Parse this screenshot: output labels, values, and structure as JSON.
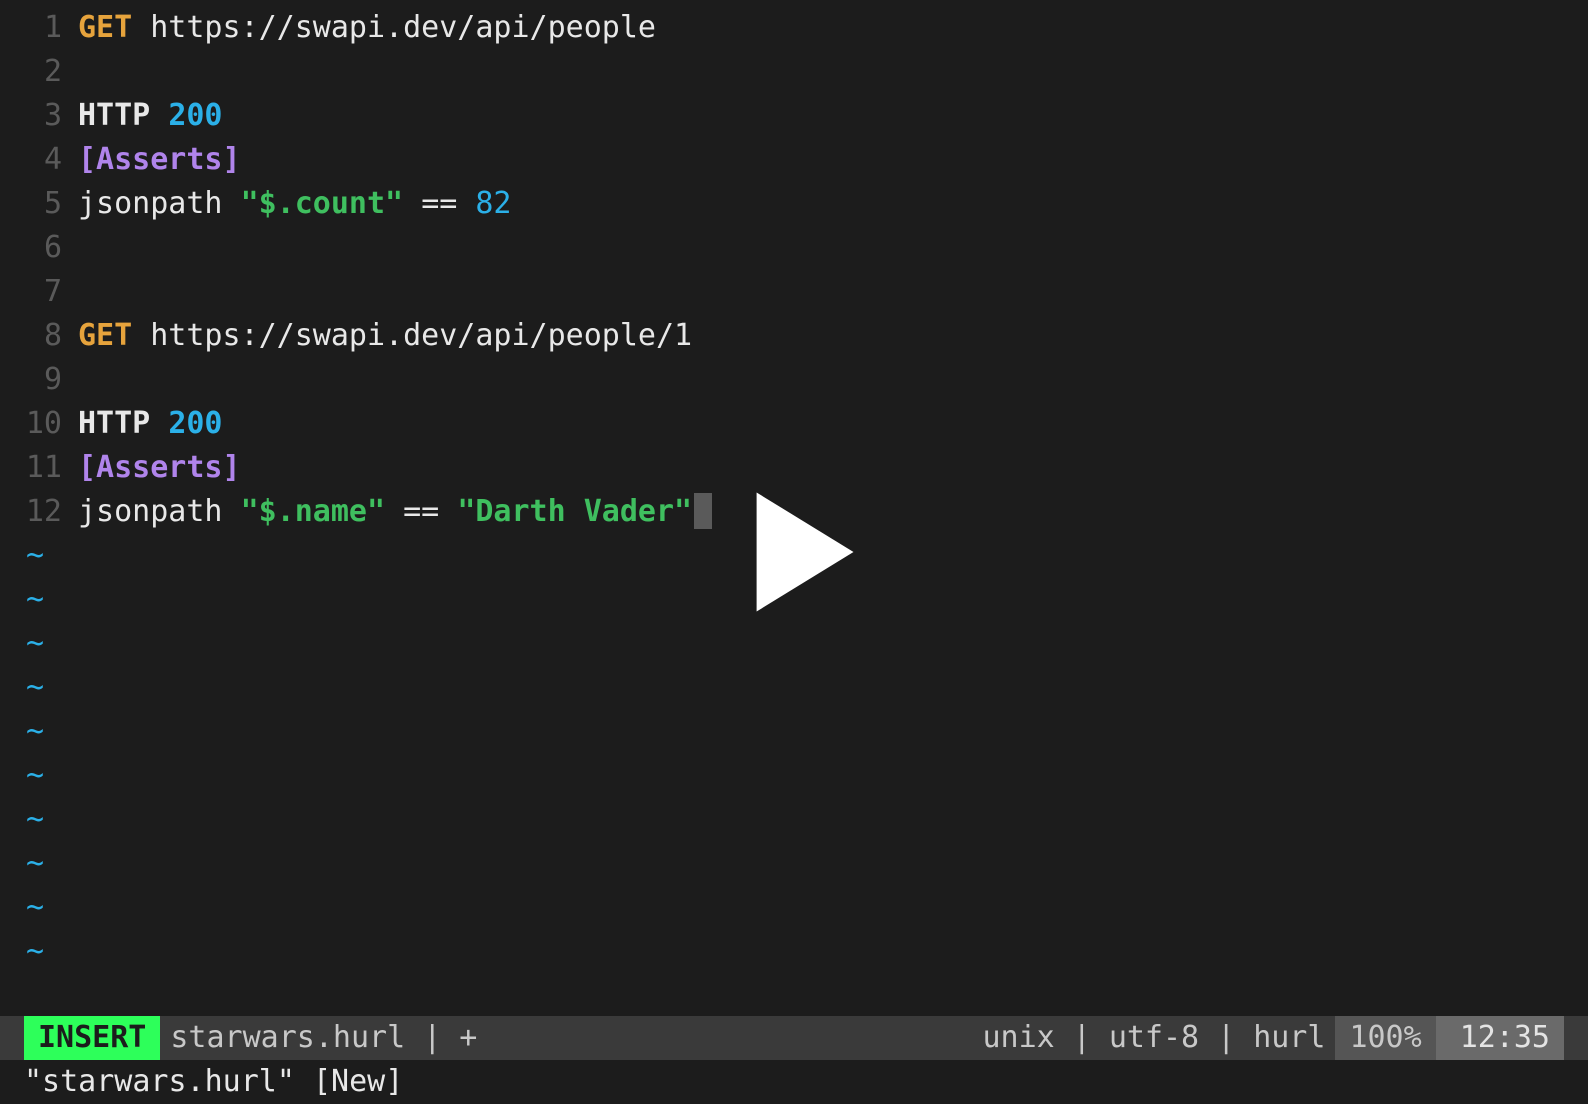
{
  "editor": {
    "lines": [
      {
        "n": "1",
        "tokens": [
          {
            "cls": "tok-method",
            "t": "GET"
          },
          {
            "cls": "",
            "t": " "
          },
          {
            "cls": "tok-url",
            "t": "https://swapi.dev/api/people"
          }
        ]
      },
      {
        "n": "2",
        "tokens": []
      },
      {
        "n": "3",
        "tokens": [
          {
            "cls": "tok-http",
            "t": "HTTP"
          },
          {
            "cls": "",
            "t": " "
          },
          {
            "cls": "tok-status",
            "t": "200"
          }
        ]
      },
      {
        "n": "4",
        "tokens": [
          {
            "cls": "tok-section",
            "t": "[Asserts]"
          }
        ]
      },
      {
        "n": "5",
        "tokens": [
          {
            "cls": "tok-func",
            "t": "jsonpath"
          },
          {
            "cls": "",
            "t": " "
          },
          {
            "cls": "tok-string",
            "t": "\"$.count\""
          },
          {
            "cls": "",
            "t": " "
          },
          {
            "cls": "tok-op",
            "t": "=="
          },
          {
            "cls": "",
            "t": " "
          },
          {
            "cls": "tok-number",
            "t": "82"
          }
        ]
      },
      {
        "n": "6",
        "tokens": []
      },
      {
        "n": "7",
        "tokens": []
      },
      {
        "n": "8",
        "tokens": [
          {
            "cls": "tok-method",
            "t": "GET"
          },
          {
            "cls": "",
            "t": " "
          },
          {
            "cls": "tok-url",
            "t": "https://swapi.dev/api/people/1"
          }
        ]
      },
      {
        "n": "9",
        "tokens": []
      },
      {
        "n": "10",
        "tokens": [
          {
            "cls": "tok-http",
            "t": "HTTP"
          },
          {
            "cls": "",
            "t": " "
          },
          {
            "cls": "tok-status",
            "t": "200"
          }
        ]
      },
      {
        "n": "11",
        "tokens": [
          {
            "cls": "tok-section",
            "t": "[Asserts]"
          }
        ]
      },
      {
        "n": "12",
        "tokens": [
          {
            "cls": "tok-func",
            "t": "jsonpath"
          },
          {
            "cls": "",
            "t": " "
          },
          {
            "cls": "tok-string",
            "t": "\"$.name\""
          },
          {
            "cls": "",
            "t": " "
          },
          {
            "cls": "tok-op",
            "t": "=="
          },
          {
            "cls": "",
            "t": " "
          },
          {
            "cls": "tok-string",
            "t": "\"Darth Vader\""
          }
        ],
        "cursor": true
      }
    ],
    "tilde": "~",
    "tilde_count": 10
  },
  "statusline": {
    "mode": "INSERT",
    "filename": "starwars.hurl",
    "modified": "+",
    "fileformat": "unix",
    "encoding": "utf-8",
    "filetype": "hurl",
    "percent": "100%",
    "position": "12:35",
    "sep": "|"
  },
  "cmdline": {
    "text": "\"starwars.hurl\" [New]"
  },
  "overlay": {
    "play_label": "Play"
  }
}
